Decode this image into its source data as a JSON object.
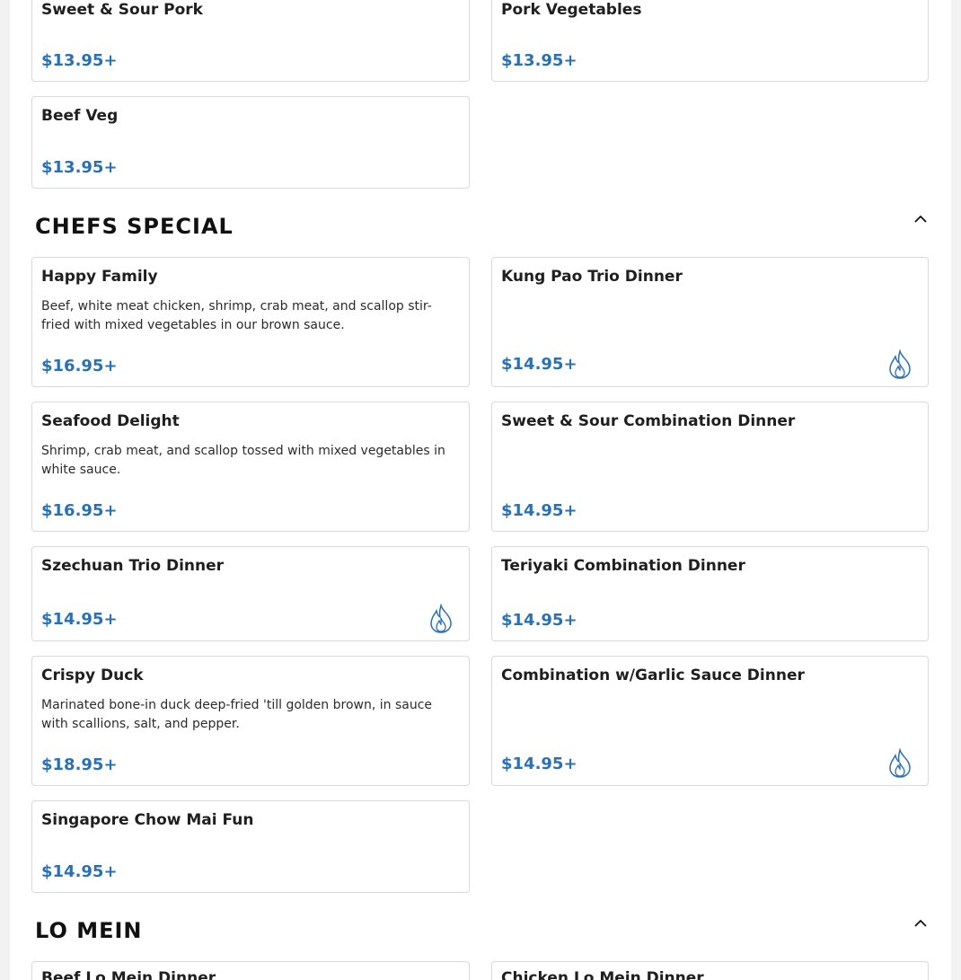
{
  "section_prev": {
    "items": [
      {
        "name": "Sweet & Sour Pork",
        "price": "$13.95+"
      },
      {
        "name": "Pork Vegetables",
        "price": "$13.95+"
      },
      {
        "name": "Beef Veg",
        "price": "$13.95+"
      }
    ]
  },
  "chefs_special": {
    "title": "CHEFS SPECIAL",
    "toggle_icon": "chevron-up-icon",
    "items": [
      {
        "name": "Happy Family",
        "description": "Beef, white meat chicken, shrimp, crab meat, and scallop stir-fried with mixed vegetables in our brown sauce.",
        "price": "$16.95+",
        "spicy": false
      },
      {
        "name": "Kung Pao Trio Dinner",
        "price": "$14.95+",
        "spicy": true
      },
      {
        "name": "Seafood Delight",
        "description": "Shrimp, crab meat, and scallop tossed with mixed vegetables in white sauce.",
        "price": "$16.95+",
        "spicy": false
      },
      {
        "name": "Sweet & Sour Combination Dinner",
        "price": "$14.95+",
        "spicy": false
      },
      {
        "name": "Szechuan Trio Dinner",
        "price": "$14.95+",
        "spicy": true
      },
      {
        "name": "Teriyaki Combination Dinner",
        "price": "$14.95+",
        "spicy": false
      },
      {
        "name": "Crispy Duck",
        "description": "Marinated bone-in duck deep-fried 'till golden brown, in sauce with scallions, salt, and pepper.",
        "price": "$18.95+",
        "spicy": false
      },
      {
        "name": "Combination w/Garlic Sauce Dinner",
        "price": "$14.95+",
        "spicy": true
      },
      {
        "name": "Singapore Chow Mai Fun",
        "price": "$14.95+",
        "spicy": false
      }
    ]
  },
  "lo_mein": {
    "title": "LO MEIN",
    "toggle_icon": "chevron-up-icon",
    "items": [
      {
        "name": "Beef Lo Mein Dinner"
      },
      {
        "name": "Chicken Lo Mein Dinner"
      }
    ]
  },
  "colors": {
    "price": "#2a71b3",
    "spicy_icon": "#2a71b3",
    "border": "#d9d9d9"
  }
}
